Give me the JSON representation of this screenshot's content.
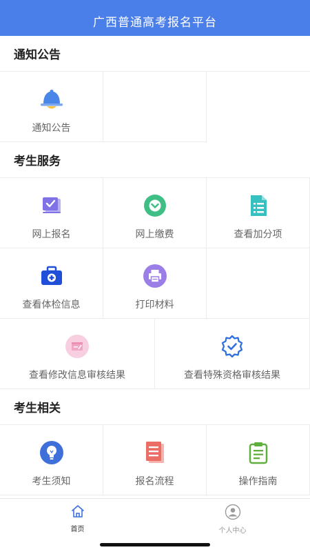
{
  "header": {
    "title": "广西普通高考报名平台",
    "color": "#4a7ee8"
  },
  "sections": {
    "notice": {
      "title": "通知公告",
      "items": [
        {
          "label": "通知公告",
          "icon": "bell-icon"
        }
      ]
    },
    "services": {
      "title": "考生服务",
      "items": [
        {
          "label": "网上报名",
          "icon": "online-registration-icon"
        },
        {
          "label": "网上缴费",
          "icon": "online-payment-icon"
        },
        {
          "label": "查看加分项",
          "icon": "bonus-points-document-icon"
        },
        {
          "label": "查看体检信息",
          "icon": "medical-kit-icon"
        },
        {
          "label": "打印材料",
          "icon": "printer-icon"
        },
        {
          "label": "查看修改信息审核结果",
          "icon": "modify-info-review-icon"
        },
        {
          "label": "查看特殊资格审核结果",
          "icon": "verified-badge-icon"
        }
      ]
    },
    "related": {
      "title": "考生相关",
      "items": [
        {
          "label": "考生须知",
          "icon": "lightbulb-icon"
        },
        {
          "label": "报名流程",
          "icon": "process-document-icon"
        },
        {
          "label": "操作指南",
          "icon": "guide-clipboard-icon"
        }
      ]
    }
  },
  "tabbar": {
    "home_label": "首页",
    "profile_label": "个人中心",
    "active": "home"
  }
}
